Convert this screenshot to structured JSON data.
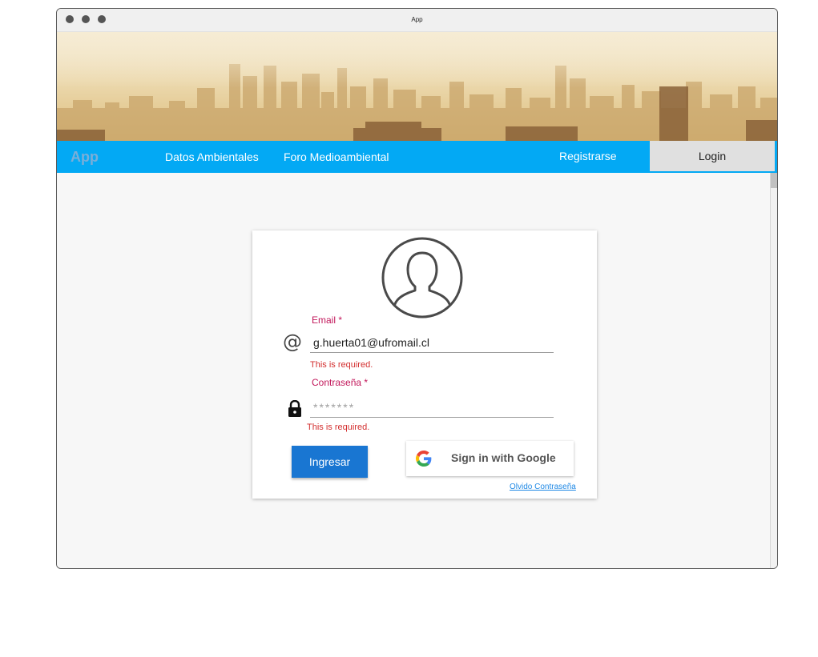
{
  "window": {
    "title": "App"
  },
  "navbar": {
    "brand": "App",
    "links": [
      "Datos Ambientales",
      "Foro Medioambiental"
    ],
    "register": "Registrarse",
    "login": "Login"
  },
  "form": {
    "email": {
      "label": "Email *",
      "value": "g.huerta01@ufromail.cl",
      "error": "This is required."
    },
    "password": {
      "label": "Contraseña *",
      "placeholder": "*******",
      "error": "This is required."
    },
    "submit_label": "Ingresar",
    "google_label": "Sign in with Google",
    "forgot_label": "Olvido Contraseña"
  },
  "colors": {
    "navbar": "#03a9f4",
    "label": "#c2185b",
    "error": "#d32f2f",
    "primary_button": "#1976d2",
    "link": "#1e88e5"
  },
  "icons": [
    "at-sign-icon",
    "lock-icon",
    "user-avatar-icon",
    "google-logo-icon"
  ]
}
